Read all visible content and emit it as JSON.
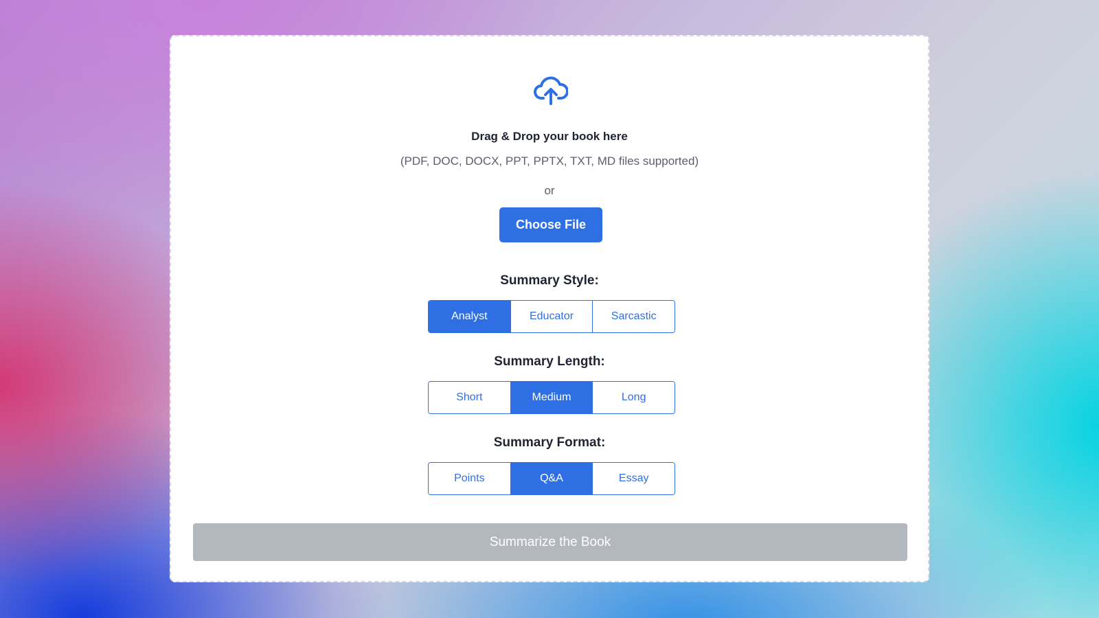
{
  "upload": {
    "icon": "cloud-upload-icon",
    "title": "Drag & Drop your book here",
    "supported": "(PDF, DOC, DOCX, PPT, PPTX, TXT, MD files supported)",
    "or": "or",
    "choose_label": "Choose File"
  },
  "style": {
    "label": "Summary Style:",
    "options": [
      "Analyst",
      "Educator",
      "Sarcastic"
    ],
    "selected": "Analyst"
  },
  "length": {
    "label": "Summary Length:",
    "options": [
      "Short",
      "Medium",
      "Long"
    ],
    "selected": "Medium"
  },
  "format": {
    "label": "Summary Format:",
    "options": [
      "Points",
      "Q&A",
      "Essay"
    ],
    "selected": "Q&A"
  },
  "action": {
    "summarize_label": "Summarize the Book",
    "enabled": false
  },
  "colors": {
    "accent": "#2f6fe4",
    "disabled_button": "#b3b7be"
  }
}
